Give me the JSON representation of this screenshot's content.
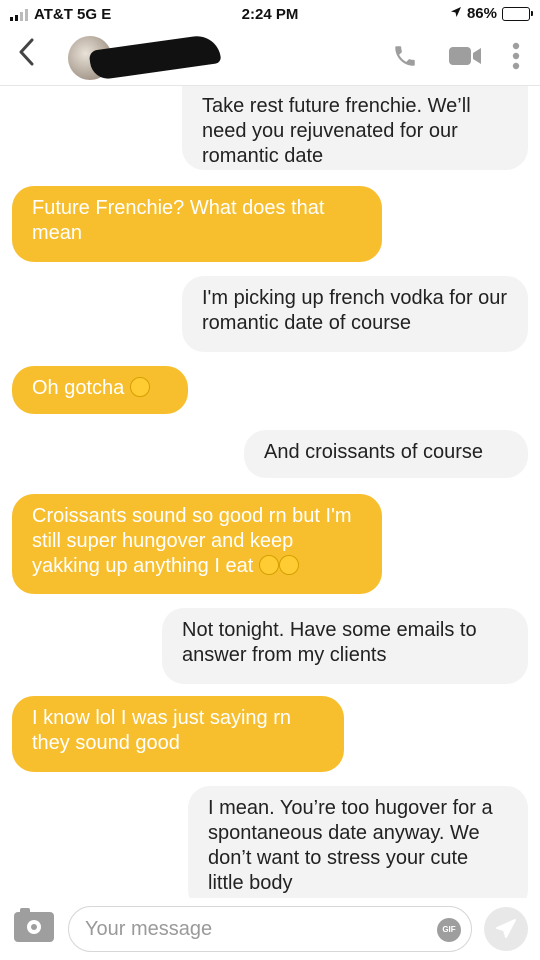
{
  "status": {
    "carrier": "AT&T 5G E",
    "time": "2:24 PM",
    "battery": "86%",
    "battery_level": 0.86
  },
  "header": {
    "back_icon": "chevron-left-icon",
    "call_icon": "phone-icon",
    "video_icon": "video-camera-icon",
    "more_icon": "more-vertical-icon"
  },
  "messages": [
    {
      "dir": "out",
      "text": "Take rest future frenchie. We’ll need you rejuvenated for our romantic date"
    },
    {
      "dir": "in",
      "text": "Future Frenchie? What does that mean"
    },
    {
      "dir": "out",
      "text": "I'm picking up french vodka for our romantic date of course"
    },
    {
      "dir": "in",
      "text": "Oh gotcha"
    },
    {
      "dir": "out",
      "text": "And croissants of course"
    },
    {
      "dir": "in",
      "text": "Croissants sound so good rn but I'm still super hungover and keep yakking up anything I eat"
    },
    {
      "dir": "out",
      "text": "Not tonight. Have some emails to answer from my clients"
    },
    {
      "dir": "in",
      "text": "I know lol I was just saying rn they sound good"
    },
    {
      "dir": "out",
      "text": "I mean. You’re too hugover for a spontaneous date anyway. We don’t want to stress your cute little body"
    }
  ],
  "composer": {
    "placeholder": "Your message",
    "gif_label": "GIF"
  },
  "colors": {
    "incoming_bubble": "#f7bf2e",
    "outgoing_bubble": "#f3f3f3"
  }
}
